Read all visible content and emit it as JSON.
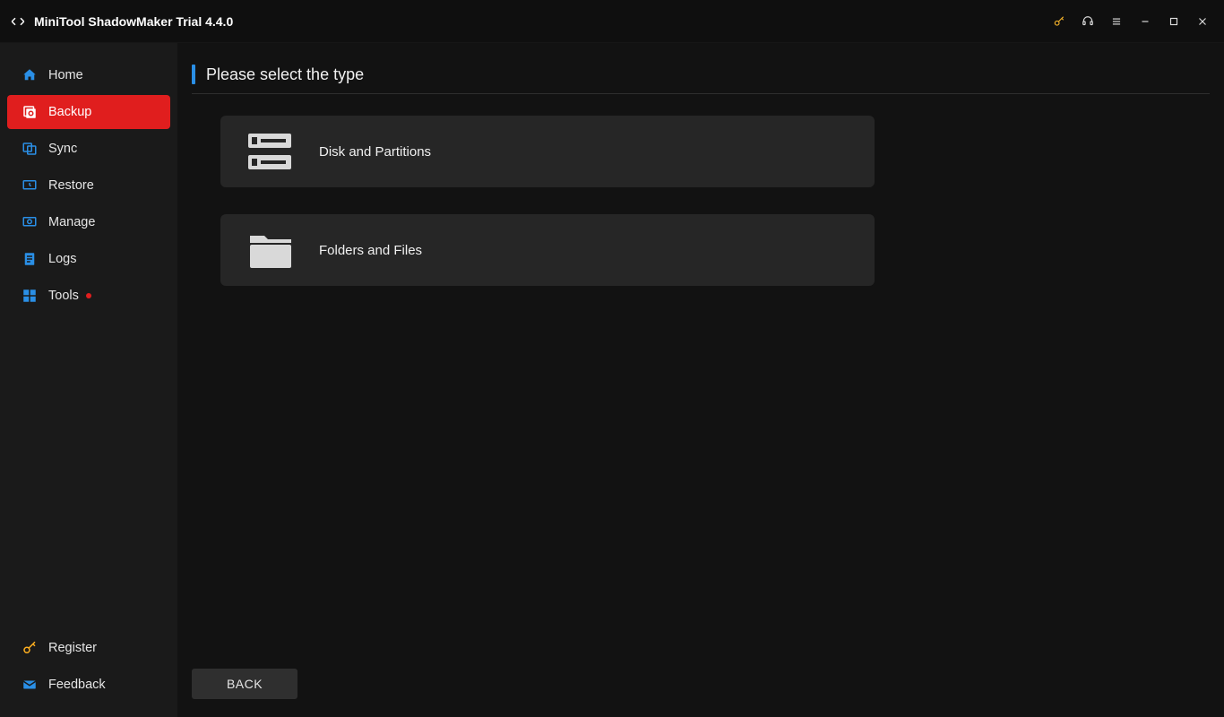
{
  "window": {
    "title": "MiniTool ShadowMaker Trial 4.4.0"
  },
  "sidebar": {
    "items": [
      {
        "label": "Home"
      },
      {
        "label": "Backup"
      },
      {
        "label": "Sync"
      },
      {
        "label": "Restore"
      },
      {
        "label": "Manage"
      },
      {
        "label": "Logs"
      },
      {
        "label": "Tools"
      }
    ],
    "bottom": [
      {
        "label": "Register"
      },
      {
        "label": "Feedback"
      }
    ]
  },
  "main": {
    "heading": "Please select the type",
    "options": [
      {
        "label": "Disk and Partitions"
      },
      {
        "label": "Folders and Files"
      }
    ],
    "back_label": "BACK"
  }
}
